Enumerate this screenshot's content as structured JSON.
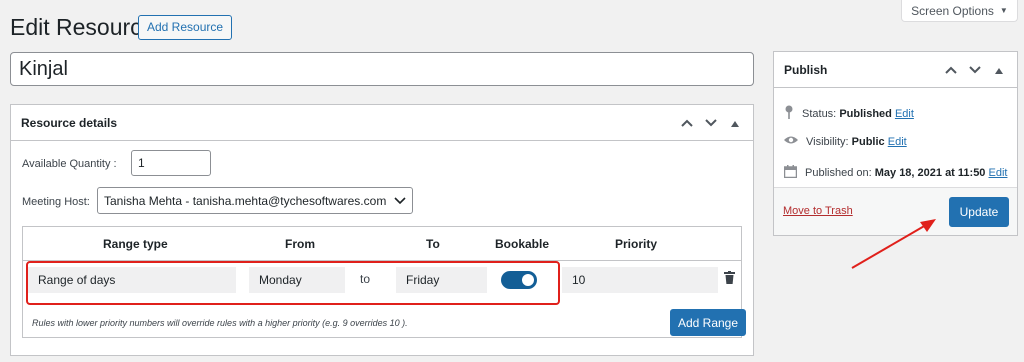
{
  "header": {
    "title": "Edit Resource",
    "add_button": "Add Resource",
    "screen_options": "Screen Options"
  },
  "title_field": {
    "value": "Kinjal"
  },
  "resource_details": {
    "heading": "Resource details",
    "available_qty_label": "Available Quantity :",
    "available_qty_value": "1",
    "meeting_host_label": "Meeting Host:",
    "meeting_host_value": "Tanisha Mehta - tanisha.mehta@tychesoftwares.com",
    "columns": [
      "Range type",
      "From",
      "To",
      "Bookable",
      "Priority"
    ],
    "row": {
      "range_type": "Range of days",
      "from": "Monday",
      "to_sep": "to",
      "to": "Friday",
      "bookable": true,
      "priority": "10"
    },
    "note": "Rules with lower priority numbers will override rules with a higher priority (e.g. 9 overrides 10 ).",
    "add_range": "Add Range"
  },
  "publish": {
    "heading": "Publish",
    "status_label": "Status:",
    "status_value": "Published",
    "visibility_label": "Visibility:",
    "visibility_value": "Public",
    "published_label": "Published on:",
    "published_value": "May 18, 2021 at 11:50",
    "edit": "Edit",
    "trash": "Move to Trash",
    "update": "Update"
  },
  "colors": {
    "accent": "#2271b1",
    "highlight": "#e0201b",
    "toggle": "#135e96"
  }
}
